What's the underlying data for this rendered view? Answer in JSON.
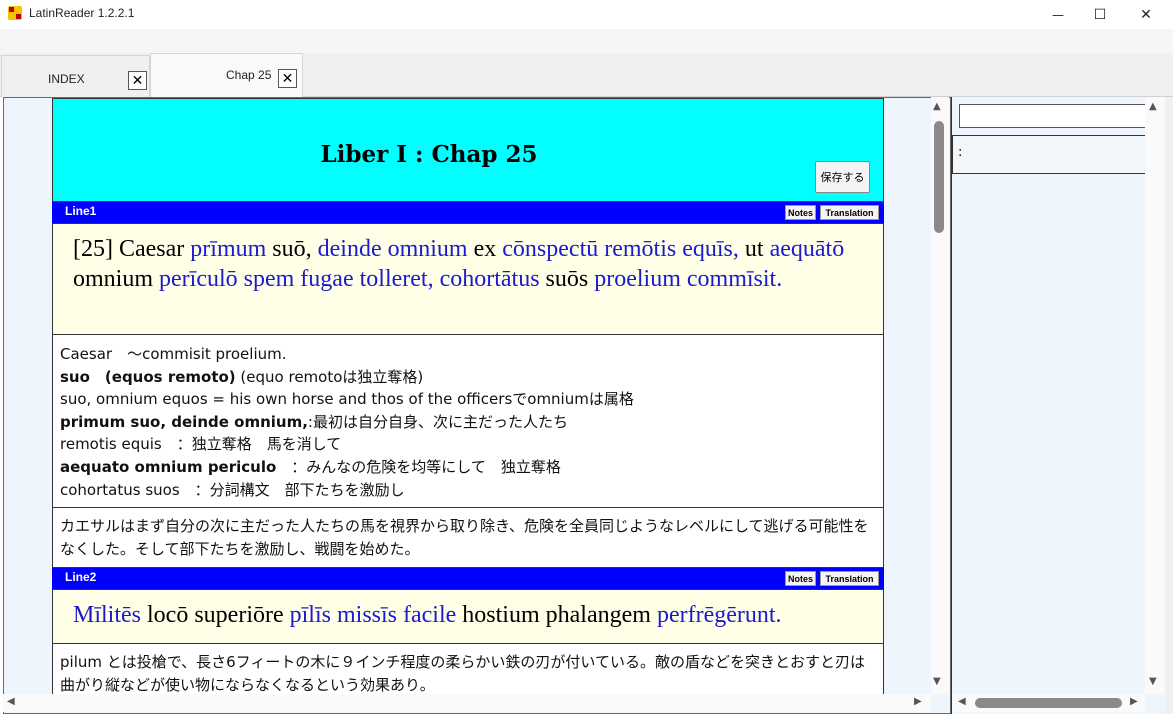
{
  "window": {
    "title": "LatinReader 1.2.2.1",
    "minimize": "—",
    "maximize": "☐",
    "close": "✕"
  },
  "tabs": [
    {
      "label": "INDEX",
      "close": "✕"
    },
    {
      "label": "Chap 25",
      "close": "✕"
    }
  ],
  "header": {
    "title": "Liber I : Chap 25",
    "save_label": "保存する",
    "background": "#00ffff"
  },
  "lines": [
    {
      "label": "Line1",
      "notes_label": "Notes",
      "translation_label": "Translation",
      "latin": [
        {
          "t": "[25] Caesar ",
          "hl": false
        },
        {
          "t": "prīmum",
          "hl": true
        },
        {
          "t": " suō, ",
          "hl": false
        },
        {
          "t": "deinde omnium",
          "hl": true
        },
        {
          "t": " ex ",
          "hl": false
        },
        {
          "t": "cōnspectū remōtis equīs,",
          "hl": true
        },
        {
          "t": " ut ",
          "hl": false
        },
        {
          "t": "aequātō",
          "hl": true
        },
        {
          "t": " omnium ",
          "hl": false
        },
        {
          "t": "perīculō spem fugae tolleret, cohortātus",
          "hl": true
        },
        {
          "t": " suōs ",
          "hl": false
        },
        {
          "t": "proelium commīsit.",
          "hl": true
        }
      ],
      "notes": [
        [
          {
            "t": "Caesar　～commisit proelium.",
            "b": false
          }
        ],
        [
          {
            "t": "suo　(equos remoto)",
            "b": true
          },
          {
            "t": " (equo remotoは独立奪格)",
            "b": false
          }
        ],
        [
          {
            "t": "suo, omnium equos = his own horse and thos of the officersでomniumは属格",
            "b": false
          }
        ],
        [
          {
            "t": "primum suo, deinde omnium,",
            "b": true
          },
          {
            "t": ":最初は自分自身、次に主だった人たち",
            "b": false
          }
        ],
        [
          {
            "t": "remotis equis　：独立奪格　馬を消して",
            "b": false
          }
        ],
        [
          {
            "t": "aequato omnium periculo",
            "b": true
          },
          {
            "t": "　：みんなの危険を均等にして　独立奪格",
            "b": false
          }
        ],
        [
          {
            "t": "cohortatus suos　：分詞構文　部下たちを激励し",
            "b": false
          }
        ]
      ],
      "translation": "カエサルはまず自分の次に主だった人たちの馬を視界から取り除き、危険を全員同じようなレベルにして逃げる可能性をなくした。そして部下たちを激励し、戦闘を始めた。"
    },
    {
      "label": "Line2",
      "notes_label": "Notes",
      "translation_label": "Translation",
      "latin": [
        {
          "t": "Mīlitēs",
          "hl": true
        },
        {
          "t": " locō superiōre ",
          "hl": false
        },
        {
          "t": "pīlīs missīs facile",
          "hl": true
        },
        {
          "t": " hostium phalangem ",
          "hl": false
        },
        {
          "t": "perfrēgērunt.",
          "hl": true
        }
      ],
      "notes_text": "pilum とは投槍で、長さ6フィートの木に９インチ程度の柔らかい鉄の刃が付いている。敵の盾などを突きとおすと刃は曲がり縦などが使い物にならなくなるという効果あり。"
    }
  ],
  "side": {
    "search_value": "",
    "box_text": ":"
  },
  "colors": {
    "line_bar": "#0000ff",
    "latin_highlight": "#1a1ad0",
    "latin_bg": "#ffffe8"
  }
}
